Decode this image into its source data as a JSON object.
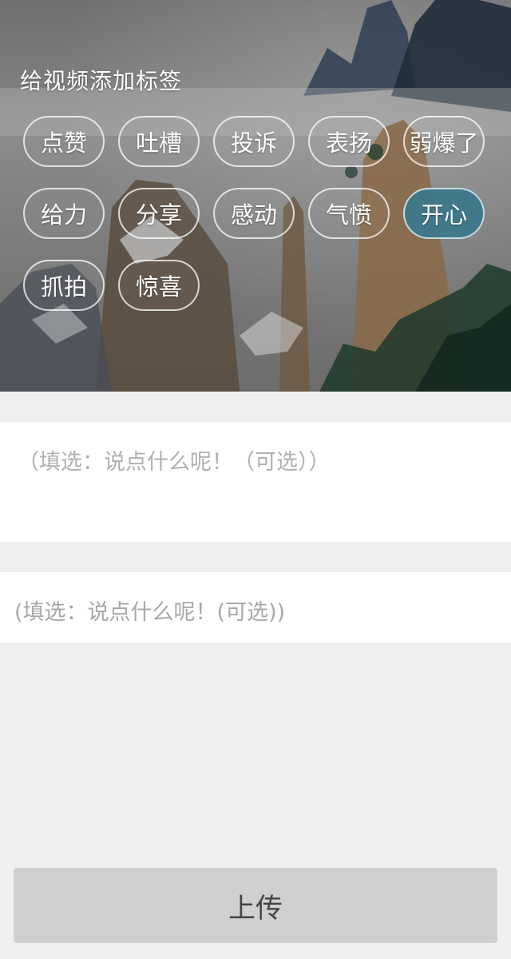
{
  "hero": {
    "title": "给视频添加标签"
  },
  "tags": {
    "rows": [
      [
        "点赞",
        "吐槽",
        "投诉",
        "表扬",
        "弱爆了"
      ],
      [
        "给力",
        "分享",
        "感动",
        "气愤",
        "开心"
      ],
      [
        "抓拍",
        "惊喜"
      ]
    ],
    "selected": "开心"
  },
  "form": {
    "comment_placeholder": "（填选：说点什么呢！（可选））",
    "comment2_placeholder": "(填选：说点什么呢！(可选))"
  },
  "actions": {
    "upload_label": "上传"
  },
  "colors": {
    "selected_tag": "#3a788c",
    "button_bg": "#cfcfcf",
    "page_bg": "#efefef"
  }
}
